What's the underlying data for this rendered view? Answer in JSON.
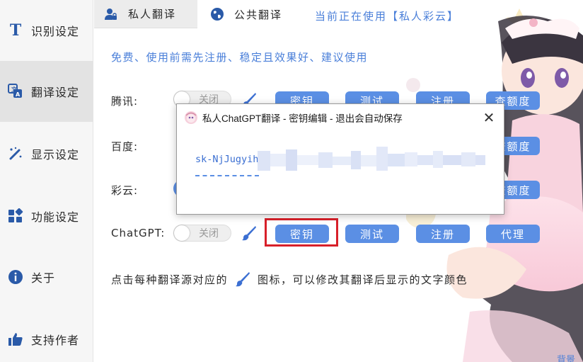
{
  "sidebar": {
    "items": [
      {
        "label": "识别设定",
        "icon": "text-t-icon"
      },
      {
        "label": "翻译设定",
        "icon": "translate-icon"
      },
      {
        "label": "显示设定",
        "icon": "magic-wand-icon"
      },
      {
        "label": "功能设定",
        "icon": "grid-icon"
      },
      {
        "label": "关于",
        "icon": "info-icon"
      },
      {
        "label": "支持作者",
        "icon": "thumbs-up-icon"
      }
    ]
  },
  "tabs": [
    {
      "label": "私人翻译",
      "icon": "user-lock-icon"
    },
    {
      "label": "公共翻译",
      "icon": "globe-icon"
    }
  ],
  "current_use": "当前正在使用【私人彩云】",
  "description": "免费、使用前需先注册、稳定且效果好、建议使用",
  "rows": [
    {
      "name": "腾讯:",
      "toggle": "关闭",
      "buttons": [
        "密钥",
        "测试",
        "注册",
        "查额度"
      ]
    },
    {
      "name": "百度:",
      "buttons": [
        "查额度"
      ]
    },
    {
      "name": "彩云:",
      "buttons": [
        "查额度"
      ]
    },
    {
      "name": "ChatGPT:",
      "toggle": "关闭",
      "buttons": [
        "密钥",
        "测试",
        "注册",
        "代理"
      ]
    }
  ],
  "footer": {
    "before": "点击每种翻译源对应的",
    "after": "图标，可以修改其翻译后显示的文字颜色"
  },
  "corner_text": "背景图",
  "dialog": {
    "title": "私人ChatGPT翻译 - 密钥编辑 - 退出会自动保存",
    "close": "✕",
    "key_value": "sk-NjJugyih"
  },
  "colors": {
    "accent": "#5b8fe4",
    "link": "#4a7fd9",
    "highlight": "#d8202a",
    "sidebar_icon": "#2a5aa8"
  }
}
